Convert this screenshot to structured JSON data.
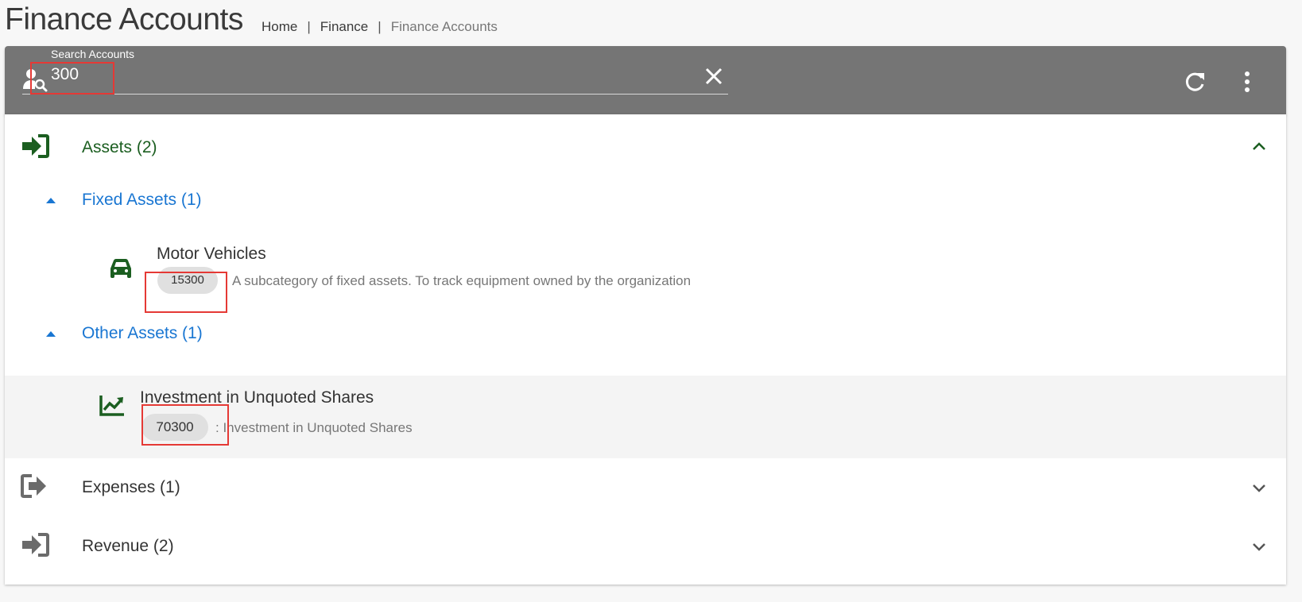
{
  "page": {
    "title": "Finance Accounts",
    "breadcrumb": [
      "Home",
      "Finance",
      "Finance Accounts"
    ],
    "separator": "|"
  },
  "search": {
    "label": "Search Accounts",
    "value": "300"
  },
  "colors": {
    "toolbar": "#757575",
    "green": "#1b5e20",
    "blue": "#1976d2",
    "annotation": "#e53935",
    "chip": "#e0e0e0"
  },
  "groups": [
    {
      "label": "Assets (2)",
      "icon": "sign-in-icon",
      "expanded": true,
      "subgroups": [
        {
          "label": "Fixed Assets (1)",
          "accounts": [
            {
              "name": "Motor Vehicles",
              "code": "15300",
              "description": "A subcategory of fixed assets. To track equipment owned by the organization",
              "icon": "car-icon"
            }
          ]
        },
        {
          "label": "Other Assets (1)",
          "accounts": [
            {
              "name": "Investment in Unquoted Shares",
              "code": "70300",
              "description": ": Investment in Unquoted Shares",
              "icon": "trending-up-icon"
            }
          ]
        }
      ]
    },
    {
      "label": "Expenses (1)",
      "icon": "sign-out-icon",
      "expanded": false
    },
    {
      "label": "Revenue (2)",
      "icon": "sign-in-icon",
      "expanded": false
    }
  ]
}
